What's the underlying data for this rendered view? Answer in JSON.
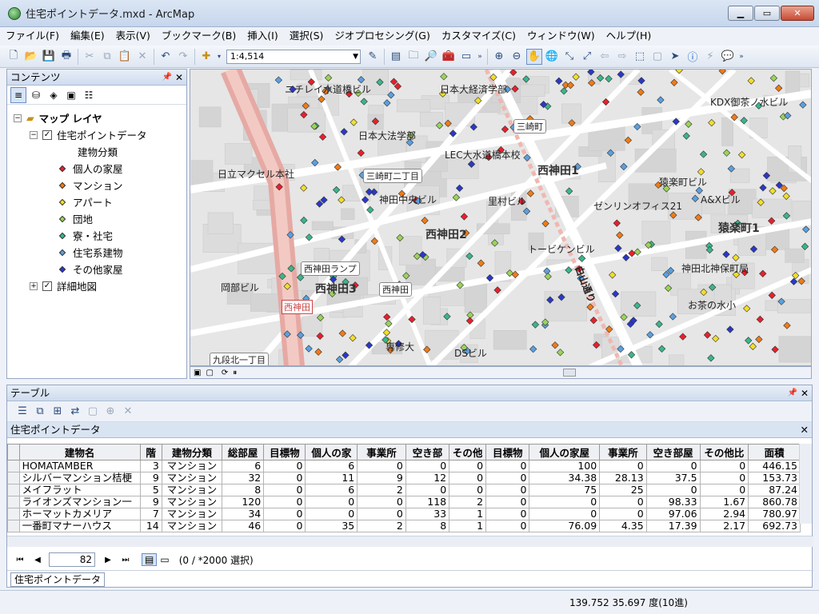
{
  "window": {
    "title": "住宅ポイントデータ.mxd - ArcMap"
  },
  "menu": [
    "ファイル(F)",
    "編集(E)",
    "表示(V)",
    "ブックマーク(B)",
    "挿入(I)",
    "選択(S)",
    "ジオプロセシング(G)",
    "カスタマイズ(C)",
    "ウィンドウ(W)",
    "ヘルプ(H)"
  ],
  "toolbar": {
    "scale": "1:4,514"
  },
  "toc": {
    "title": "コンテンツ",
    "root": "マップ レイヤ",
    "layer": "住宅ポイントデータ",
    "field": "建物分類",
    "classes": [
      {
        "label": "個人の家屋",
        "color": "#e8202a"
      },
      {
        "label": "マンション",
        "color": "#f07b16"
      },
      {
        "label": "アパート",
        "color": "#f2de2a"
      },
      {
        "label": "団地",
        "color": "#9bd35a"
      },
      {
        "label": "寮・社宅",
        "color": "#3bb58a"
      },
      {
        "label": "住宅系建物",
        "color": "#5aa0e0"
      },
      {
        "label": "その他家屋",
        "color": "#2a38c8"
      }
    ],
    "detail_layer": "詳細地図"
  },
  "map": {
    "labels": [
      "ニチレイ水道橋ビル",
      "日本大経済学部",
      "KDX御茶ノ水ビル",
      "三崎町",
      "日本大法学部",
      "LEC大水道橋本校",
      "西神田1",
      "日立マクセル本社",
      "三崎町二丁目",
      "猿楽町ビル",
      "神田中央ビル",
      "里村ビル",
      "ゼンリンオフィス21",
      "A&Xビル",
      "西神田2",
      "猿楽町1",
      "トービケンビル",
      "西神田ランプ",
      "神田北神保町局",
      "岡部ビル",
      "西神田3",
      "西神田",
      "白山通り",
      "お茶の水小",
      "西神田",
      "専修大",
      "DSビル",
      "九段北一丁目"
    ]
  },
  "table": {
    "panel_title": "テーブル",
    "name": "住宅ポイントデータ",
    "columns": [
      "建物名",
      "階",
      "建物分類",
      "総部屋",
      "目標物",
      "個人の家",
      "事業所",
      "空き部",
      "その他",
      "目標物",
      "個人の家屋",
      "事業所",
      "空き部屋",
      "その他比",
      "面積"
    ],
    "rows": [
      [
        "HOMATAMBER",
        "3",
        "マンション",
        "6",
        "0",
        "6",
        "0",
        "0",
        "0",
        "0",
        "100",
        "0",
        "0",
        "0",
        "446.15"
      ],
      [
        "シルバーマンション桔梗",
        "9",
        "マンション",
        "32",
        "0",
        "11",
        "9",
        "12",
        "0",
        "0",
        "34.38",
        "28.13",
        "37.5",
        "0",
        "153.73"
      ],
      [
        "メイフラット",
        "5",
        "マンション",
        "8",
        "0",
        "6",
        "2",
        "0",
        "0",
        "0",
        "75",
        "25",
        "0",
        "0",
        "87.24"
      ],
      [
        "ライオンズマンション一",
        "9",
        "マンション",
        "120",
        "0",
        "0",
        "0",
        "118",
        "2",
        "0",
        "0",
        "0",
        "98.33",
        "1.67",
        "860.78"
      ],
      [
        "ホーマットカメリア",
        "7",
        "マンション",
        "34",
        "0",
        "0",
        "0",
        "33",
        "1",
        "0",
        "0",
        "0",
        "97.06",
        "2.94",
        "780.97"
      ],
      [
        "一番町マナーハウス",
        "14",
        "マンション",
        "46",
        "0",
        "35",
        "2",
        "8",
        "1",
        "0",
        "76.09",
        "4.35",
        "17.39",
        "2.17",
        "692.73"
      ]
    ],
    "record": "82",
    "selection": "(0 / *2000 選択)",
    "tab": "住宅ポイントデータ"
  },
  "status": {
    "coords": "139.752  35.697 度(10進)"
  }
}
